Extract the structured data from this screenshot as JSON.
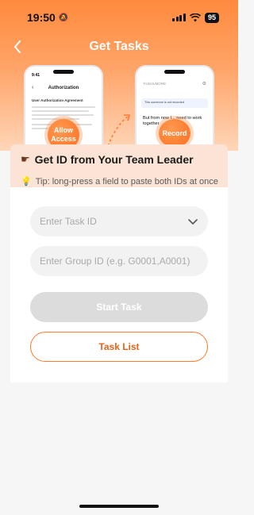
{
  "status": {
    "time": "19:50",
    "battery": "95"
  },
  "nav": {
    "title": "Get Tasks"
  },
  "illustration": {
    "left_phone": {
      "time": "9:41",
      "title": "Authorization",
      "heading": "User Authorization Agreement"
    },
    "right_phone": {
      "search": "TASKS/MORE",
      "banner": "This someone is not recorded",
      "body": "But from now I... need to work together"
    },
    "allow_bubble": "Allow Access",
    "record_bubble": "Record"
  },
  "section": {
    "icon": "point-right-icon",
    "title": "Get ID from Your Team Leader",
    "tip": "Tip: long-press a field to paste both IDs at once"
  },
  "form": {
    "task_id_placeholder": "Enter Task ID",
    "group_id_placeholder": "Enter Group ID (e.g. G0001,A0001)",
    "start_label": "Start Task",
    "task_list_label": "Task List"
  },
  "colors": {
    "accent": "#ff7a2e",
    "disabled": "#dcdcdc"
  }
}
